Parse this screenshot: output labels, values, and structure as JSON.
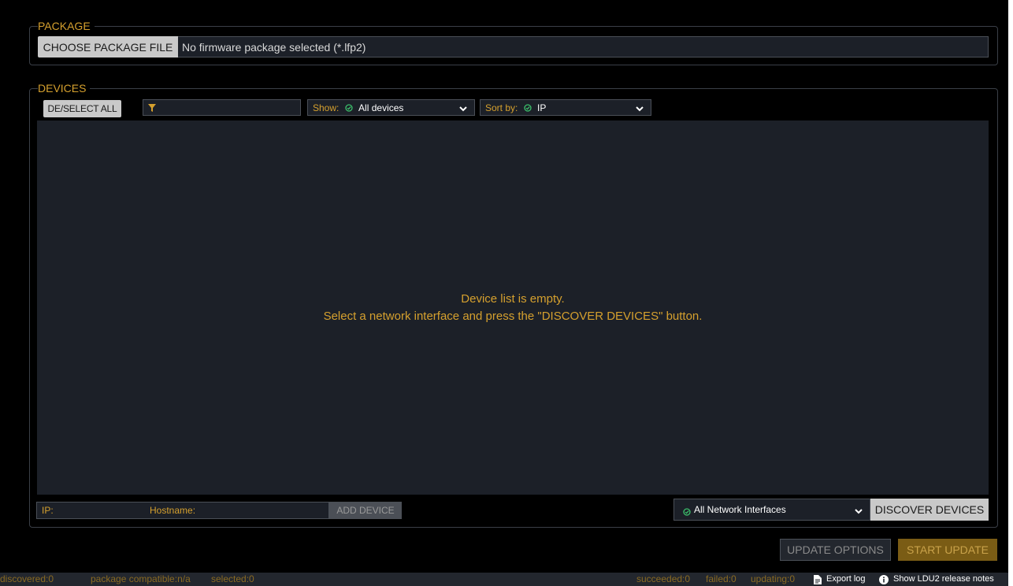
{
  "package": {
    "legend": "PACKAGE",
    "choose_button": "CHOOSE PACKAGE FILE",
    "file_text": "No firmware package selected (*.lfp2)"
  },
  "devices": {
    "legend": "DEVICES",
    "deselect_all": "DE/SELECT ALL",
    "filter_value": "",
    "show_label": "Show:",
    "show_value": "All devices",
    "sort_label": "Sort by:",
    "sort_value": "IP",
    "empty_line1": "Device list is empty.",
    "empty_line2": "Select a network interface and press the \"DISCOVER DEVICES\" button.",
    "ip_placeholder": "IP:",
    "hostname_placeholder": "Hostname:",
    "add_device": "ADD DEVICE",
    "network_interface": "All Network Interfaces",
    "discover_button": "DISCOVER DEVICES"
  },
  "actions": {
    "update_options": "UPDATE OPTIONS",
    "start_update": "START UPDATE"
  },
  "status": {
    "discovered": "discovered:0",
    "package_compatible": "package compatible:n/a",
    "selected": "selected:0",
    "succeeded": "succeeded:0",
    "failed": "failed:0",
    "updating": "updating:0",
    "export_log": "Export log",
    "release_notes": "Show LDU2 release notes"
  },
  "icons": {
    "filter": "filter-icon",
    "check": "check-circle-icon",
    "chevron": "chevron-down-icon",
    "document": "document-icon",
    "info": "info-icon"
  },
  "colors": {
    "accent": "#d5a02e",
    "check_green": "#3bbf6b",
    "panel": "#1c2028",
    "background": "#000000"
  }
}
